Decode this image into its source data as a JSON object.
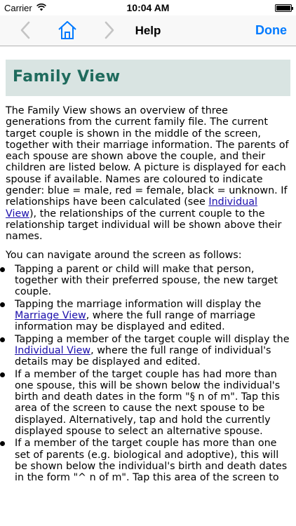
{
  "status_bar": {
    "carrier": "Carrier",
    "time": "10:04 AM"
  },
  "nav": {
    "title": "Help",
    "done_label": "Done",
    "back_icon": "chevron-left-icon",
    "home_icon": "home-icon",
    "forward_icon": "chevron-right-icon",
    "accent_color": "#007aff"
  },
  "page": {
    "heading": "Family View",
    "intro": {
      "before_link": "The Family View shows an overview of three generations from the current family file.  The current target couple is shown in the middle of the screen, together with their marriage information.  The parents of each spouse are shown above the couple, and their children are listed below.  A picture is displayed for each spouse if available.  Names are coloured to indicate gender: blue = male, red = female, black = unknown.  If relationships have been calculated (see ",
      "link": "Individual View",
      "after_link": "), the relationships of the current couple to the relationship target individual will be shown above their names."
    },
    "navigate_text": "You can navigate around the screen as follows:",
    "items": [
      {
        "text": "Tapping a parent or child will make that person, together with their preferred spouse, the new target couple."
      },
      {
        "before": "Tapping the marriage information will display the ",
        "link": "Marriage View",
        "after": ", where the full range of marriage information may be displayed and edited."
      },
      {
        "before": "Tapping a member of the target couple will display the ",
        "link": "Individual View",
        "after": ", where the full range of individual's details may be displayed and edited."
      },
      {
        "text": "If a member of the target couple has had more than one spouse, this will be shown below the individual's birth and death dates in the form \"§ n of m\".  Tap this area of the screen to cause the next spouse to be displayed.  Alternatively, tap and hold the currently displayed spouse to select an alternative spouse."
      },
      {
        "text": "If a member of the target couple has more than one set of parents (e.g. biological and adoptive), this will be shown below the individual's birth and death dates in the form \"^ n of m\".  Tap this area of the screen to"
      }
    ],
    "heading_color": "#1f6b5d",
    "heading_bg": "#d9e4e2",
    "link_color": "#1a0dab"
  }
}
